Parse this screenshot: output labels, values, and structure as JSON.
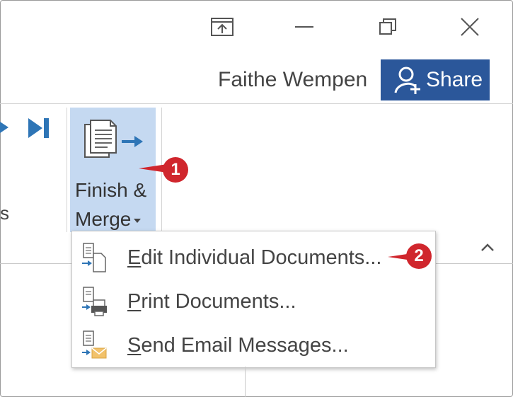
{
  "window": {
    "user_name": "Faithe Wempen",
    "share_label": "Share"
  },
  "ribbon": {
    "finish_merge": {
      "line1": "Finish &",
      "line2": "Merge"
    },
    "partial_left_text": "s"
  },
  "menu": {
    "items": [
      {
        "label": "Edit Individual Documents...",
        "accel": "E",
        "icon": "edit-documents-icon"
      },
      {
        "label": "Print Documents...",
        "accel": "P",
        "icon": "print-documents-icon"
      },
      {
        "label": "Send Email Messages...",
        "accel": "S",
        "icon": "send-email-icon"
      }
    ]
  },
  "callouts": {
    "one": "1",
    "two": "2"
  },
  "colors": {
    "accent": "#2b579a",
    "highlight": "#c5d9f1",
    "callout": "#d0262d"
  }
}
